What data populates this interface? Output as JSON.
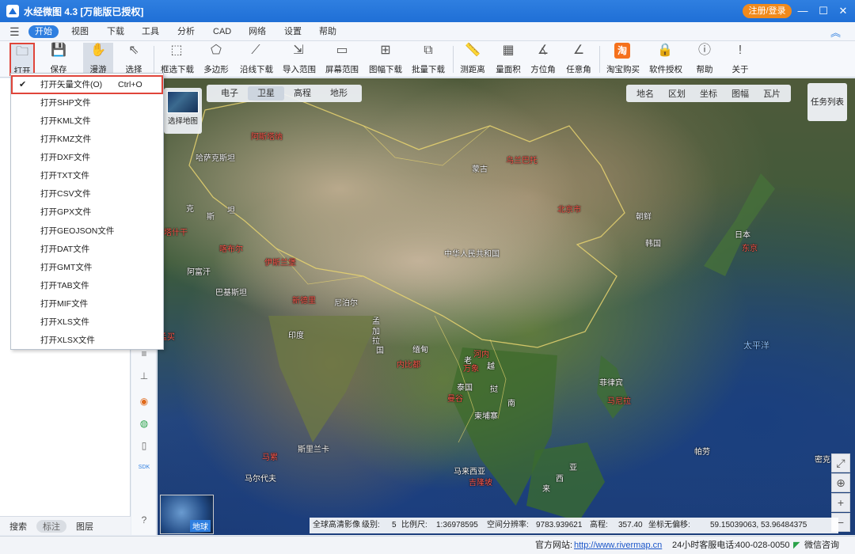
{
  "window": {
    "title": "水经微图 4.3 [万能版已授权]",
    "login_label": "注册/登录",
    "minimize": "—",
    "maximize": "☐",
    "close": "✕"
  },
  "menu": {
    "items": [
      "开始",
      "视图",
      "下载",
      "工具",
      "分析",
      "CAD",
      "网络",
      "设置",
      "帮助"
    ]
  },
  "toolbar": {
    "items": [
      {
        "label": "打开",
        "icon": "folder-icon"
      },
      {
        "label": "保存",
        "icon": "save-icon"
      },
      {
        "label": "漫游",
        "icon": "hand-icon"
      },
      {
        "label": "选择",
        "icon": "pointer-icon"
      },
      {
        "label": "框选下载",
        "icon": "box-download-icon"
      },
      {
        "label": "多边形",
        "icon": "polygon-icon"
      },
      {
        "label": "沿线下载",
        "icon": "line-download-icon"
      },
      {
        "label": "导入范围",
        "icon": "import-range-icon"
      },
      {
        "label": "屏幕范围",
        "icon": "screen-range-icon"
      },
      {
        "label": "图幅下载",
        "icon": "sheet-download-icon"
      },
      {
        "label": "批量下载",
        "icon": "batch-download-icon"
      },
      {
        "label": "测距离",
        "icon": "ruler-icon"
      },
      {
        "label": "量面积",
        "icon": "area-icon"
      },
      {
        "label": "方位角",
        "icon": "azimuth-icon"
      },
      {
        "label": "任意角",
        "icon": "angle-icon"
      },
      {
        "label": "淘宝购买",
        "icon": "taobao-icon"
      },
      {
        "label": "软件授权",
        "icon": "lock-icon"
      },
      {
        "label": "帮助",
        "icon": "help-icon"
      },
      {
        "label": "关于",
        "icon": "info-icon"
      }
    ],
    "taobao_glyph": "淘"
  },
  "dropdown": {
    "items": [
      {
        "label": "打开矢量文件(O)",
        "shortcut": "Ctrl+O",
        "checked": true
      },
      {
        "label": "打开SHP文件"
      },
      {
        "label": "打开KML文件"
      },
      {
        "label": "打开KMZ文件"
      },
      {
        "label": "打开DXF文件"
      },
      {
        "label": "打开TXT文件"
      },
      {
        "label": "打开CSV文件"
      },
      {
        "label": "打开GPX文件"
      },
      {
        "label": "打开GEOJSON文件"
      },
      {
        "label": "打开DAT文件"
      },
      {
        "label": "打开GMT文件"
      },
      {
        "label": "打开TAB文件"
      },
      {
        "label": "打开MIF文件"
      },
      {
        "label": "打开XLS文件"
      },
      {
        "label": "打开XLSX文件"
      }
    ]
  },
  "left_panel": {
    "tabs": [
      "搜索",
      "标注",
      "图层"
    ],
    "active_tab": "标注"
  },
  "map": {
    "select_map_label": "选择地图",
    "tabs": [
      "电子",
      "卫星",
      "高程",
      "地形"
    ],
    "active_tab": "卫星",
    "tools": [
      "地名",
      "区划",
      "坐标",
      "图幅",
      "瓦片"
    ],
    "task_list": "任务列表",
    "globe_label": "地球",
    "labels": [
      {
        "text": "阿斯塔纳",
        "type": "city"
      },
      {
        "text": "哈萨克斯坦",
        "type": "country"
      },
      {
        "text": "蒙古",
        "type": "country"
      },
      {
        "text": "乌兰巴托",
        "type": "city"
      },
      {
        "text": "北京市",
        "type": "city"
      },
      {
        "text": "朝鲜",
        "type": "country"
      },
      {
        "text": "韩国",
        "type": "country"
      },
      {
        "text": "日本",
        "type": "country"
      },
      {
        "text": "东京",
        "type": "city"
      },
      {
        "text": "中华人民共和国",
        "type": "country"
      },
      {
        "text": "克",
        "type": "country"
      },
      {
        "text": "斯",
        "type": "country"
      },
      {
        "text": "坦",
        "type": "country"
      },
      {
        "text": "塔什干",
        "type": "city"
      },
      {
        "text": "喀布尔",
        "type": "city"
      },
      {
        "text": "伊斯兰堡",
        "type": "city"
      },
      {
        "text": "阿富汗",
        "type": "country"
      },
      {
        "text": "巴基斯坦",
        "type": "country"
      },
      {
        "text": "新德里",
        "type": "city"
      },
      {
        "text": "尼泊尔",
        "type": "country"
      },
      {
        "text": "印度",
        "type": "country"
      },
      {
        "text": "孟",
        "type": "country"
      },
      {
        "text": "加",
        "type": "country"
      },
      {
        "text": "拉",
        "type": "country"
      },
      {
        "text": "国",
        "type": "country"
      },
      {
        "text": "孟买",
        "type": "city"
      },
      {
        "text": "缅甸",
        "type": "country"
      },
      {
        "text": "内比都",
        "type": "city"
      },
      {
        "text": "河内",
        "type": "city"
      },
      {
        "text": "老",
        "type": "country"
      },
      {
        "text": "万象",
        "type": "city"
      },
      {
        "text": "越",
        "type": "country"
      },
      {
        "text": "泰国",
        "type": "country"
      },
      {
        "text": "挝",
        "type": "country"
      },
      {
        "text": "曼谷",
        "type": "city"
      },
      {
        "text": "柬埔寨",
        "type": "country"
      },
      {
        "text": "南",
        "type": "country"
      },
      {
        "text": "菲律宾",
        "type": "country"
      },
      {
        "text": "马尼拉",
        "type": "city"
      },
      {
        "text": "太平洋",
        "type": "ocean"
      },
      {
        "text": "斯里兰卡",
        "type": "country"
      },
      {
        "text": "马累",
        "type": "city"
      },
      {
        "text": "马尔代夫",
        "type": "country"
      },
      {
        "text": "马来西亚",
        "type": "country"
      },
      {
        "text": "吉隆坡",
        "type": "city"
      },
      {
        "text": "亚",
        "type": "country"
      },
      {
        "text": "西",
        "type": "country"
      },
      {
        "text": "来",
        "type": "country"
      },
      {
        "text": "帕劳",
        "type": "country"
      },
      {
        "text": "密克",
        "type": "country"
      }
    ],
    "status": {
      "layer": "全球高清影像",
      "level_label": "级别:",
      "level": "5",
      "scale_label": "比例尺:",
      "scale": "1:36978595",
      "resolution_label": "空间分辨率:",
      "resolution": "9783.939621",
      "elevation_label": "高程:",
      "elevation": "357.40",
      "offset_label": "坐标无偏移:",
      "coords": "59.15039063, 53.96484375"
    }
  },
  "statusbar": {
    "website_label": "官方网站:",
    "website": "http://www.rivermap.cn",
    "hotline_label": "24小时客服电话:",
    "hotline": "400-028-0050",
    "wechat": "微信咨询"
  }
}
